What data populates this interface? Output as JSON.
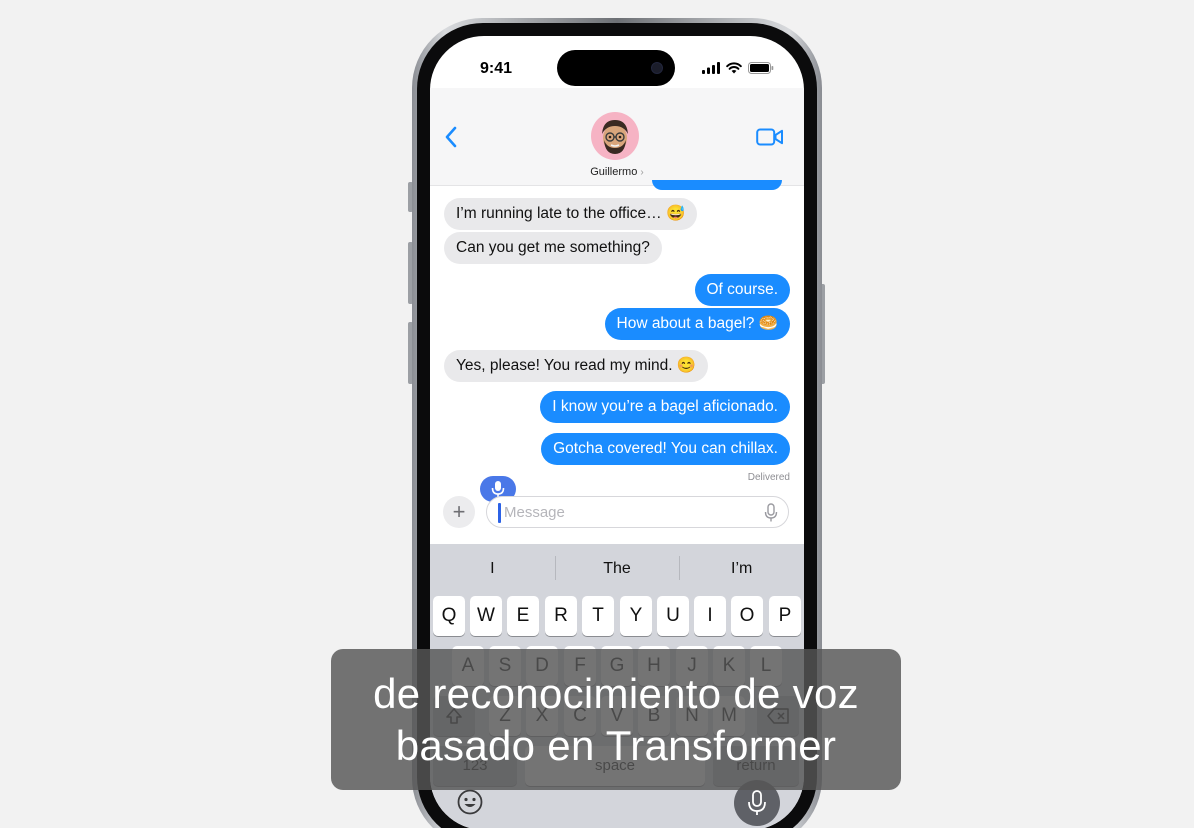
{
  "status_bar": {
    "time": "9:41"
  },
  "header": {
    "contact_name": "Guillermo",
    "name_chevron": "›"
  },
  "messages": [
    {
      "text": "I’m running late to the office… 😅",
      "direction": "received"
    },
    {
      "text": "Can you get me something?",
      "direction": "received"
    },
    {
      "text": "Of course.",
      "direction": "sent"
    },
    {
      "text": "How about a bagel? 🥯",
      "direction": "sent"
    },
    {
      "text": "Yes, please! You read my mind. 😊",
      "direction": "received"
    },
    {
      "text": "I know you’re a bagel aficionado.",
      "direction": "sent"
    },
    {
      "text": "Gotcha covered! You can chillax.",
      "direction": "sent"
    }
  ],
  "delivered_label": "Delivered",
  "composer": {
    "add_label": "+",
    "placeholder": "Message"
  },
  "predictions": [
    "I",
    "The",
    "I’m"
  ],
  "keyboard": {
    "row1": [
      "Q",
      "W",
      "E",
      "R",
      "T",
      "Y",
      "U",
      "I",
      "O",
      "P"
    ],
    "row2": [
      "A",
      "S",
      "D",
      "F",
      "G",
      "H",
      "J",
      "K",
      "L"
    ],
    "row3": [
      "Z",
      "X",
      "C",
      "V",
      "B",
      "N",
      "M"
    ],
    "space_label": "space",
    "return_label": "return"
  },
  "caption": {
    "line1": "de reconocimiento de voz",
    "line2": "basado en Transformer"
  },
  "colors": {
    "sent_bubble": "#1a8cff",
    "received_bubble": "#e9e9eb",
    "dictation_accent": "#4a78e8",
    "keyboard_bg": "#d3d5db"
  }
}
